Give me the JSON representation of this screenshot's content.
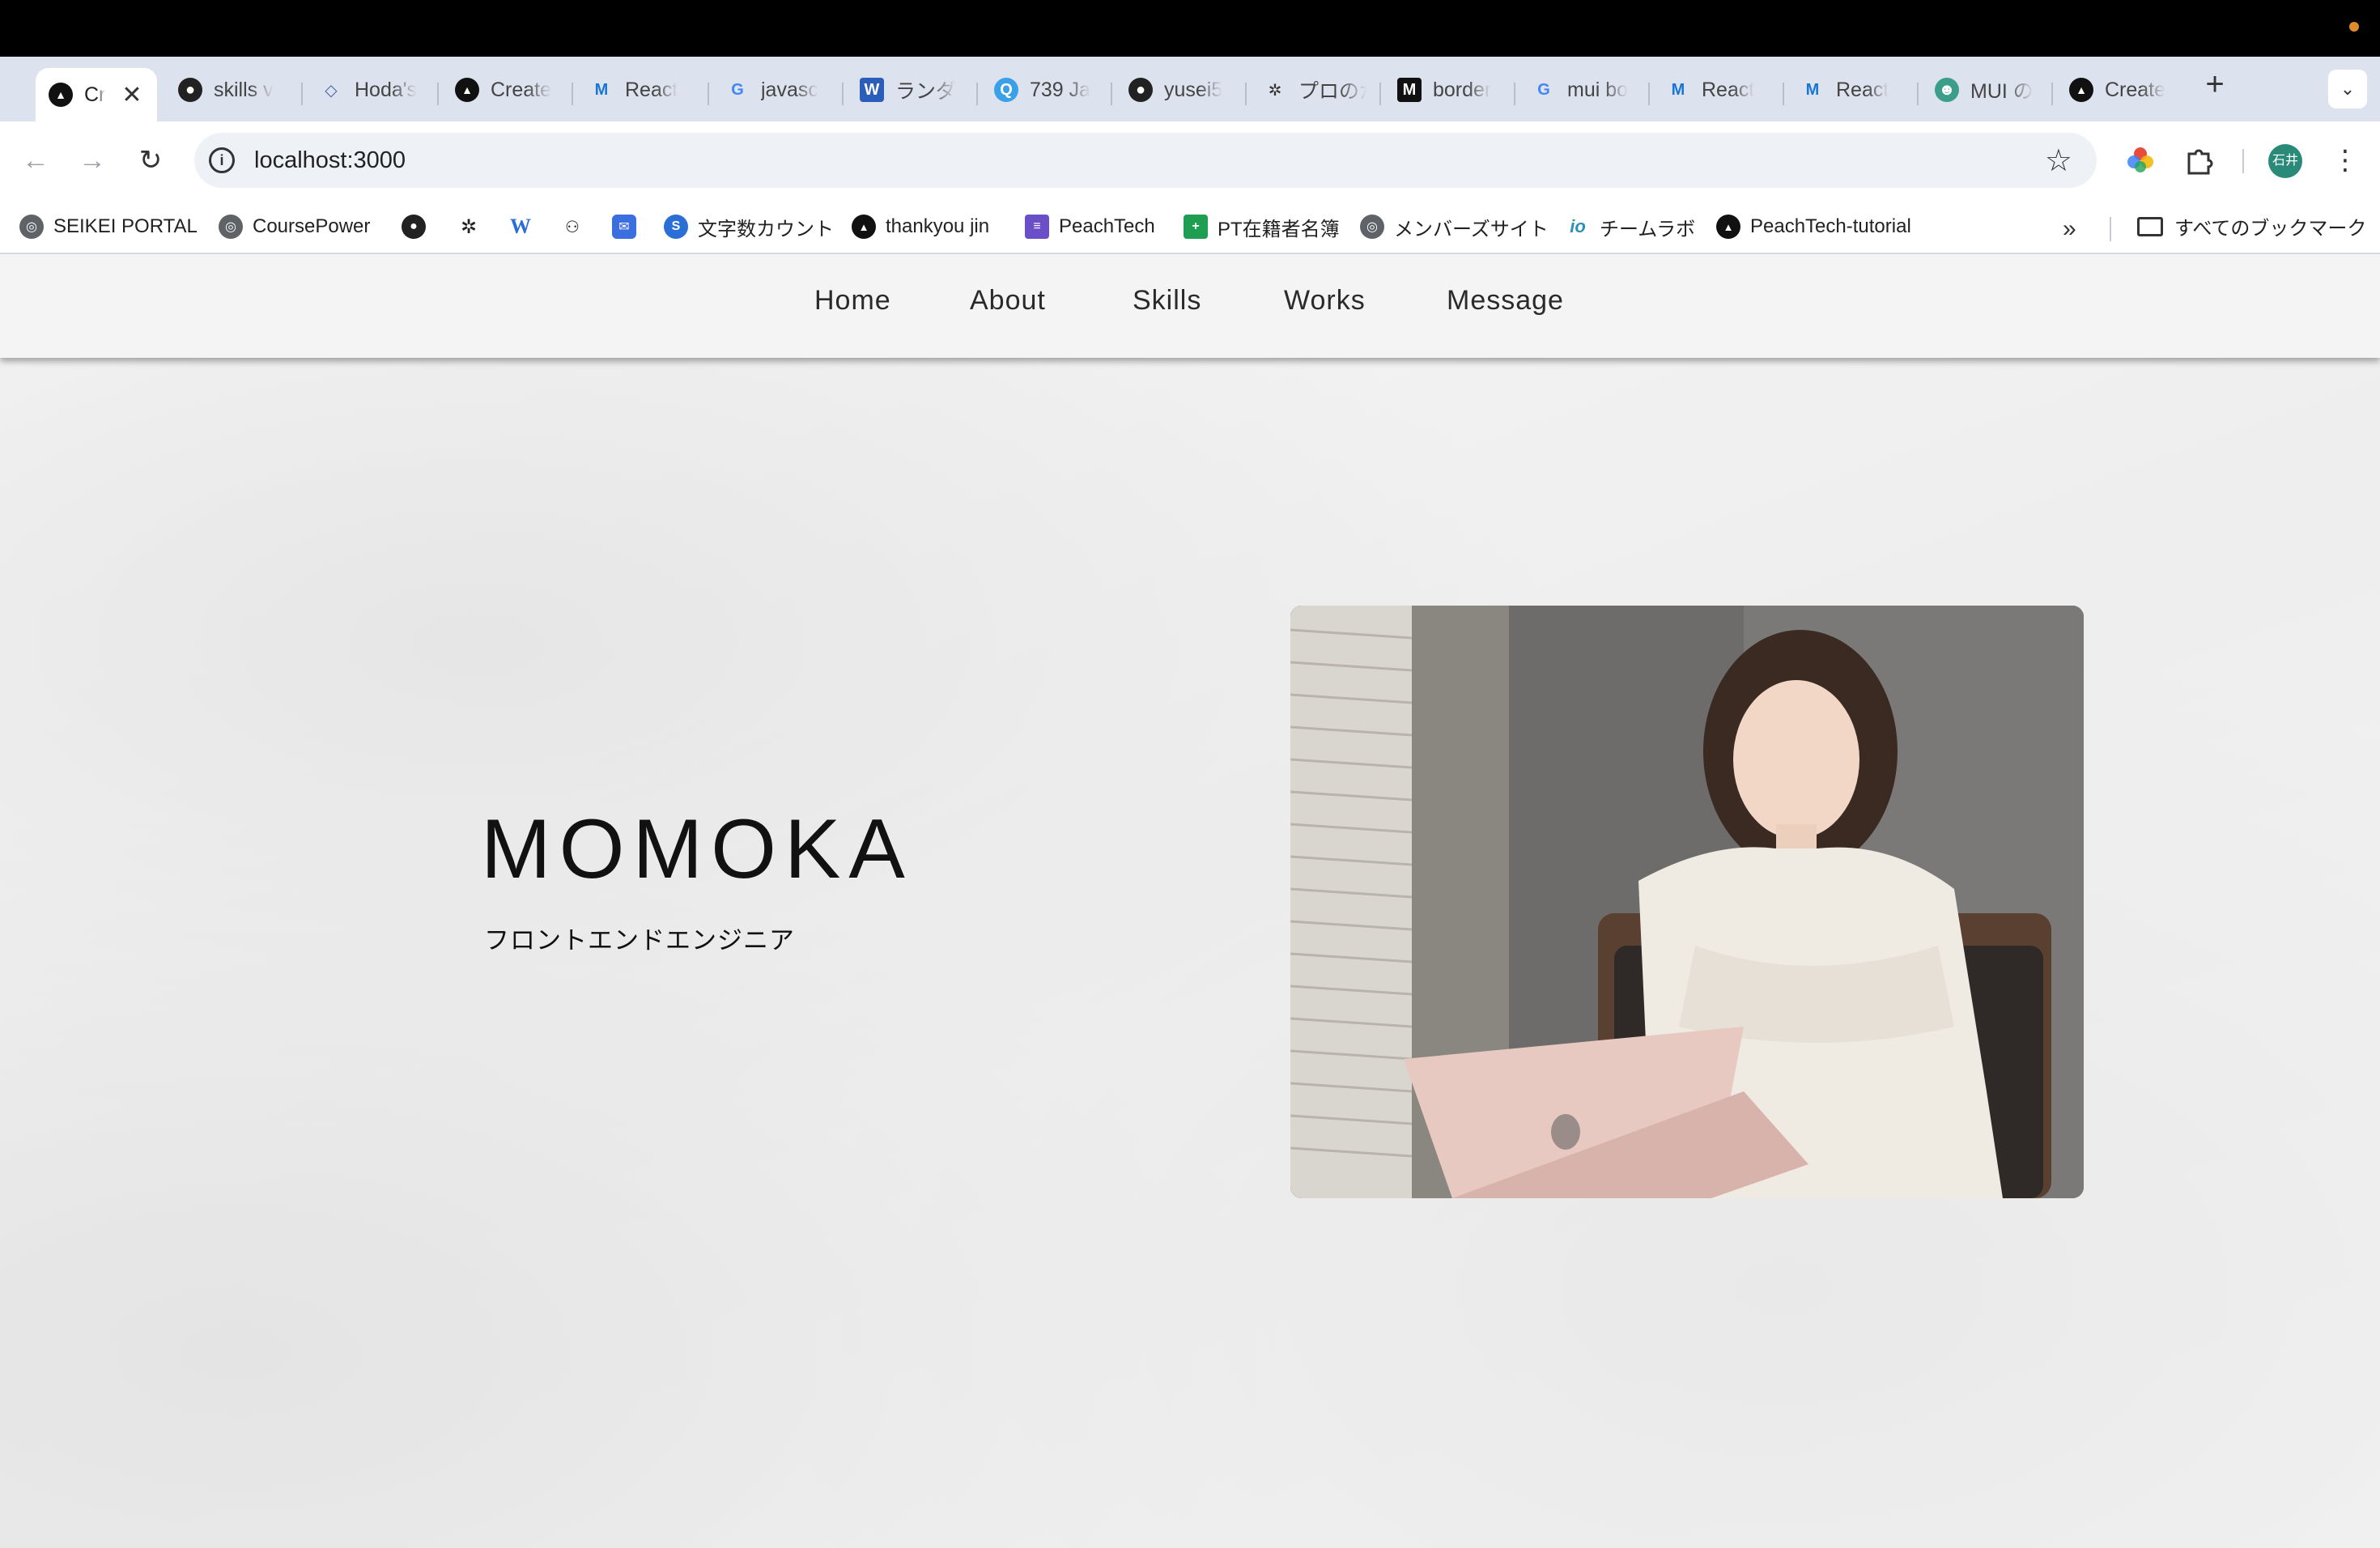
{
  "browser": {
    "tabs": [
      {
        "label": "Cr",
        "icon": "vercel-icon",
        "active": true
      },
      {
        "label": "skills v",
        "icon": "github-icon"
      },
      {
        "label": "Hoda's",
        "icon": "diamond-icon"
      },
      {
        "label": "Create",
        "icon": "vercel-icon"
      },
      {
        "label": "React",
        "icon": "mui-icon"
      },
      {
        "label": "javasc",
        "icon": "google-icon"
      },
      {
        "label": "ランダ",
        "icon": "word-icon"
      },
      {
        "label": "739 Ja",
        "icon": "search-icon"
      },
      {
        "label": "yusei5",
        "icon": "github-icon"
      },
      {
        "label": "プロのか",
        "icon": "openai-icon"
      },
      {
        "label": "border",
        "icon": "m-icon"
      },
      {
        "label": "mui bo",
        "icon": "google-icon"
      },
      {
        "label": "React",
        "icon": "mui-icon"
      },
      {
        "label": "React",
        "icon": "mui-icon"
      },
      {
        "label": "MUI の",
        "icon": "robot-icon"
      },
      {
        "label": "Create",
        "icon": "vercel-icon"
      }
    ],
    "close_glyph": "✕",
    "new_tab_glyph": "+",
    "tab_menu_glyph": "⌄",
    "url": "localhost:3000",
    "profile_initials": "石井"
  },
  "bookmarks": {
    "items": [
      {
        "label": "SEIKEI PORTAL",
        "icon": "globe-icon",
        "color": "#5f6368"
      },
      {
        "label": "CoursePower",
        "icon": "globe-icon",
        "color": "#5f6368"
      },
      {
        "label": "",
        "icon": "github-icon",
        "color": "#222222"
      },
      {
        "label": "",
        "icon": "openai-icon",
        "color": "#222222"
      },
      {
        "label": "",
        "icon": "w-icon",
        "color": "#2b6fd6"
      },
      {
        "label": "",
        "icon": "hatena-icon",
        "color": "#222222"
      },
      {
        "label": "",
        "icon": "mail-icon",
        "color": "#3b6fe0"
      },
      {
        "label": "文字数カウント",
        "icon": "s-icon",
        "color": "#2b6fd6"
      },
      {
        "label": "thankyou jin",
        "icon": "vercel-icon",
        "color": "#111111"
      },
      {
        "label": "PeachTech",
        "icon": "forms-icon",
        "color": "#6b4fc8"
      },
      {
        "label": "PT在籍者名簿",
        "icon": "sheets-icon",
        "color": "#1e9e50"
      },
      {
        "label": "メンバーズサイト",
        "icon": "globe-icon",
        "color": "#5f6368"
      },
      {
        "label": "チームラボ",
        "icon": "io-icon",
        "color": "#2e8fb8"
      },
      {
        "label": "PeachTech-tutorial",
        "icon": "vercel-icon",
        "color": "#111111"
      }
    ],
    "more_glyph": "»",
    "all_bookmarks_label": "すべてのブックマーク"
  },
  "site": {
    "nav": [
      "Home",
      "About",
      "Skills",
      "Works",
      "Message"
    ],
    "hero_name": "MOMOKA",
    "hero_role": "フロントエンドエンジニア",
    "photo_alt": "woman-with-laptop-photo"
  }
}
